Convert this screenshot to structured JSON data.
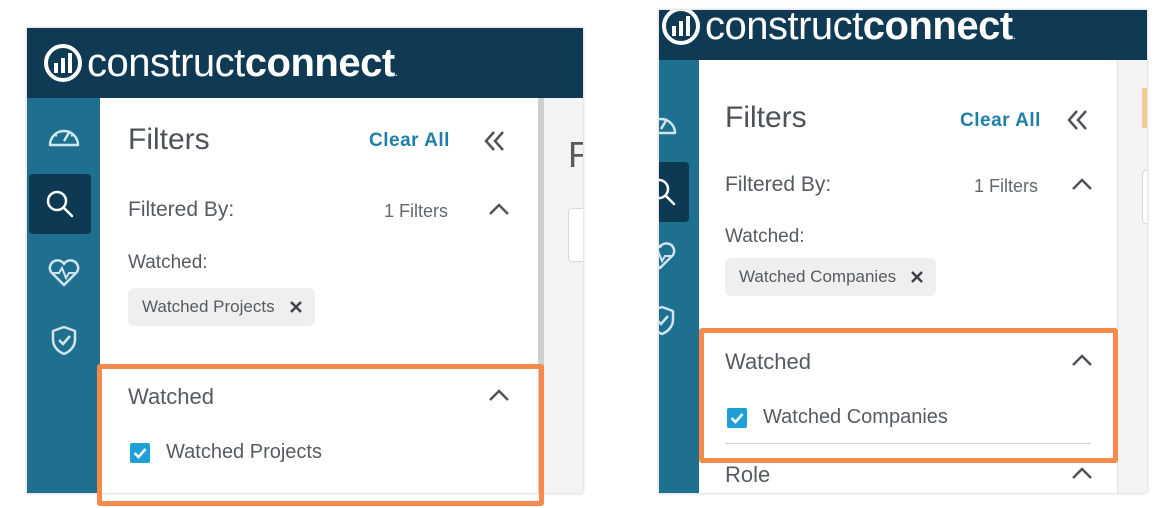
{
  "colors": {
    "header_bg": "#103a54",
    "rail_bg": "#1f6f8e",
    "rail_active": "#0d3a52",
    "link": "#1f7fa8",
    "checkbox": "#1e9fd8",
    "highlight": "#f58a4b"
  },
  "logo": {
    "light": "construct",
    "bold": "connect",
    "mark": "."
  },
  "left": {
    "rail_icons": [
      "dashboard-gauge-icon",
      "search-icon",
      "heart-pulse-icon",
      "shield-check-icon"
    ],
    "filters_title": "Filters",
    "clear_all": "Clear All",
    "filtered_by_label": "Filtered By:",
    "filter_count": "1 Filters",
    "watched_label": "Watched:",
    "chip_label": "Watched Projects",
    "section_title": "Watched",
    "checkbox_label": "Watched Projects",
    "checkbox_checked": true,
    "gutter_letter": "F"
  },
  "right": {
    "rail_icons": [
      "dashboard-gauge-icon",
      "search-icon",
      "heart-pulse-icon",
      "shield-check-icon"
    ],
    "filters_title": "Filters",
    "clear_all": "Clear All",
    "filtered_by_label": "Filtered By:",
    "filter_count": "1 Filters",
    "watched_label": "Watched:",
    "chip_label": "Watched Companies",
    "section_title": "Watched",
    "checkbox_label": "Watched Companies",
    "checkbox_checked": true,
    "next_section_title": "Role"
  }
}
